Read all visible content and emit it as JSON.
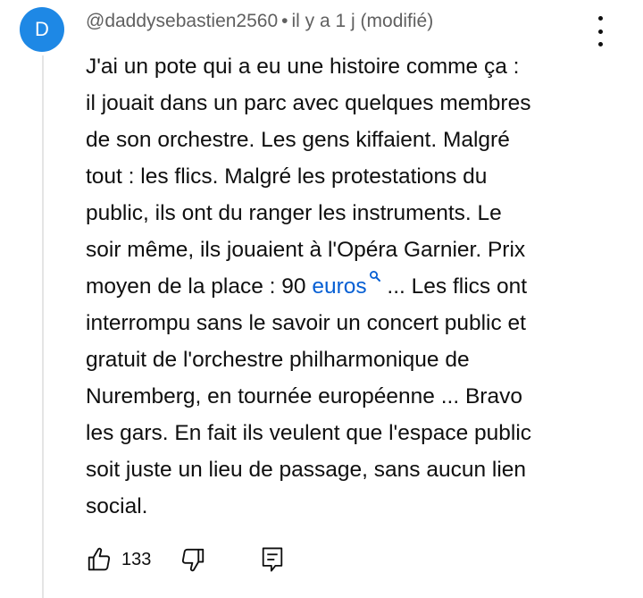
{
  "comment": {
    "avatar_letter": "D",
    "avatar_color": "#1e88e5",
    "author": "@daddysebastien2560",
    "separator": "•",
    "timestamp": "il y a 1 j (modifié)",
    "lines": [
      "J'ai un pote qui a eu une histoire comme ça :",
      "il jouait dans un parc avec quelques membres",
      "de son orchestre. Les gens kiffaient. Malgré",
      "tout : les flics. Malgré les protestations du",
      "public, ils ont du ranger les instruments. Le",
      "soir même, ils jouaient à l'Opéra Garnier. Prix"
    ],
    "line7_before": "moyen de la place : 90 ",
    "line7_link": "euros",
    "line7_after": " ... Les flics ont",
    "lines_after": [
      "interrompu sans le savoir un concert public et",
      "gratuit de l'orchestre philharmonique de",
      "Nuremberg, en tournée européenne ... Bravo",
      "les gars. En fait ils veulent que l'espace public",
      "soit juste un lieu de passage, sans aucun lien",
      "social."
    ],
    "link_color": "#065fd4",
    "like_count": "133"
  },
  "icons": {
    "menu": "more-vert-icon",
    "link_search": "search-icon",
    "like": "thumb-up-icon",
    "dislike": "thumb-down-icon",
    "reply": "comment-reply-icon"
  }
}
